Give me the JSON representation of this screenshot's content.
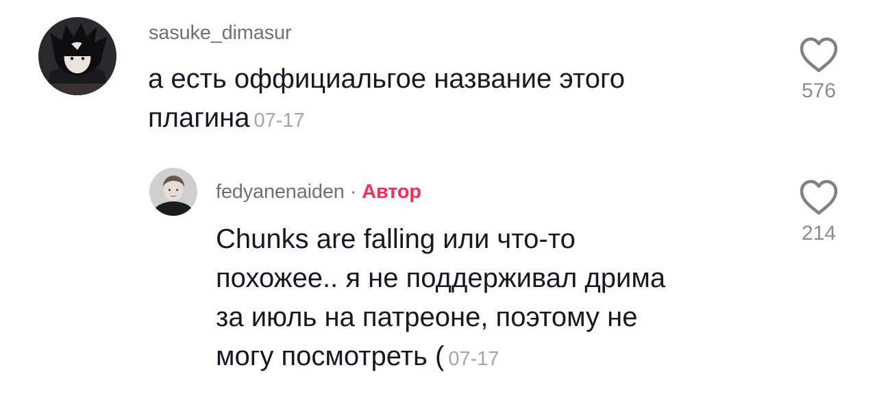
{
  "comments": [
    {
      "username": "sasuke_dimasur",
      "lines": [
        "а есть оффициальгое название этого",
        "плагина"
      ],
      "date": "07-17",
      "likes": "576"
    },
    {
      "username": "fedyanenaiden",
      "separator": "·",
      "badge": "Автор",
      "lines": [
        "Chunks are falling или что-то",
        "похожее.. я не поддерживал дрима",
        "за июль на патреоне, поэтому не",
        "могу посмотреть ("
      ],
      "date": "07-17",
      "likes": "214"
    }
  ],
  "colors": {
    "badge": "#fe2c55",
    "username": "#6f7077",
    "date": "#a3a4a9",
    "text": "#161823"
  },
  "icons": {
    "like": "heart-outline-icon"
  }
}
